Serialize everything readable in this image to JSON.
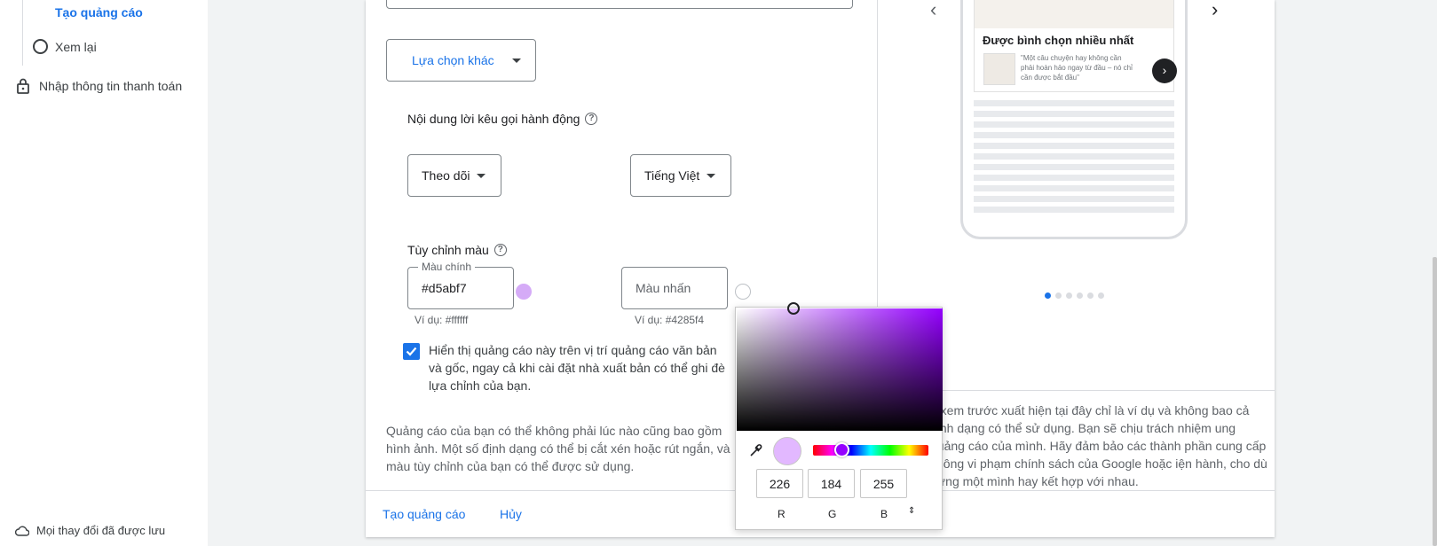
{
  "nav": {
    "step_create": "Tạo quảng cáo",
    "step_review": "Xem lại",
    "step_billing": "Nhập thông tin thanh toán",
    "saved_status": "Mọi thay đổi đã được lưu"
  },
  "form": {
    "other_options_label": "Lựa chọn khác",
    "cta_title": "Nội dung lời kêu gọi hành động",
    "cta_value": "Theo dõi",
    "language_value": "Tiếng Việt",
    "color_title": "Tùy chỉnh màu",
    "primary_color_label": "Màu chính",
    "primary_color_value": "#d5abf7",
    "primary_color_hint": "Ví dụ: #ffffff",
    "accent_color_placeholder": "Màu nhấn",
    "accent_color_hint": "Ví dụ: #4285f4",
    "checkbox_text": "Hiển thị quảng cáo này trên vị trí quảng cáo văn bản và gốc, ngay cả khi cài đặt nhà xuất bản có thể ghi đè lựa chỉnh của bạn.",
    "disclaimer": "Quảng cáo của bạn có thể không phải lúc nào cũng bao gồm hình ảnh. Một số định dạng có thể bị cắt xén hoặc rút ngắn, và màu tùy chỉnh của bạn có thể được sử dụng."
  },
  "preview": {
    "card_title": "Được bình chọn nhiều nhất",
    "card_quote": "\"Một câu chuyện hay không cần phải hoàn hảo ngay từ đầu – nó chỉ cần được bắt đầu\"",
    "disclaimer": "n xem trước xuất hiện tại đây chỉ là ví dụ và không bao cả định dạng có thể sử dụng. Bạn sẽ chịu trách nhiệm ung quảng cáo của mình. Hãy đảm bảo các thành phần cung cấp không vi phạm chính sách của Google hoặc iện hành, cho dù đứng một mình hay kết hợp với nhau.",
    "prev_arrow": "‹",
    "next_arrow": "›",
    "dot_count": 6,
    "active_dot": 0
  },
  "footer": {
    "create_label": "Tạo quảng cáo",
    "cancel_label": "Hủy"
  },
  "color_picker": {
    "r": "226",
    "g": "184",
    "b": "255",
    "r_label": "R",
    "g_label": "G",
    "b_label": "B",
    "mode_toggle": "⇕",
    "preview_color": "#e2b8ff",
    "primary_swatch_color": "#d5abf7"
  },
  "colors": {
    "accent": "#1a73e8",
    "text": "#3c4043"
  }
}
